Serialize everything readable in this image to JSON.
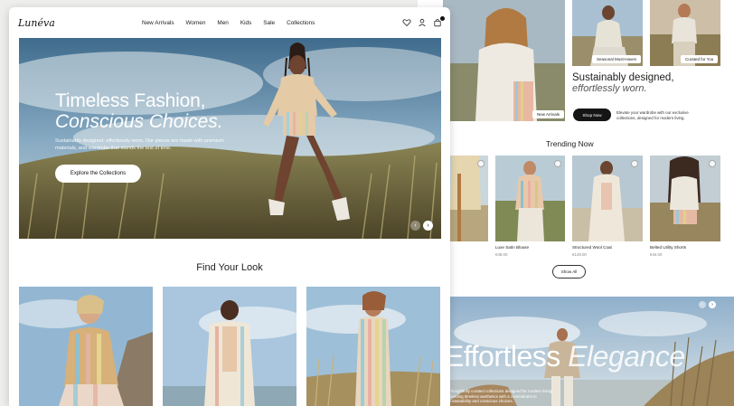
{
  "brand": {
    "logo": "Lunéva"
  },
  "nav": {
    "items": [
      {
        "label": "New Arrivals"
      },
      {
        "label": "Women"
      },
      {
        "label": "Men"
      },
      {
        "label": "Kids"
      },
      {
        "label": "Sale"
      },
      {
        "label": "Collections"
      }
    ]
  },
  "header_icons": [
    "heart-icon",
    "user-icon",
    "bag-icon"
  ],
  "hero": {
    "title_line1": "Timeless Fashion,",
    "title_line2": "Conscious Choices.",
    "description": "Sustainably designed, effortlessly worn. Our pieces are made with premium materials, and wardrobe that stands the test of time.",
    "cta": "Explore the Collections"
  },
  "find_your_look": {
    "title": "Find Your Look"
  },
  "back_page": {
    "badges": {
      "new_arrivals": "New Arrivals",
      "seasonal": "Seasonal Must-Haves",
      "curated": "Curated for You"
    },
    "sustainably": {
      "title": "Sustainably designed,",
      "subtitle": "effortlessly worn.",
      "shop_now": "Shop Now",
      "elevate": "Elevate your wardrobe with our exclusive collections, designed for modern living."
    },
    "trending": {
      "title": "Trending Now",
      "products": [
        {
          "name": "n",
          "price": ""
        },
        {
          "name": "Luxe Satin Blouse",
          "price": "€49.00"
        },
        {
          "name": "Structured Wool Coat",
          "price": "€149.00"
        },
        {
          "name": "Belted Utility Shorts",
          "price": "€44.00"
        }
      ],
      "show_all": "Show All"
    },
    "effortless": {
      "word1": "Effortless",
      "word2": "Elegance",
      "description": "Thoughtfully curated collections designed for modern living, blending timeless aesthetics with a commitment to sustainability and conscious choices."
    }
  },
  "colors": {
    "accent_dark": "#151515",
    "sky": "#8fb3cf",
    "grass": "#6e6a45"
  }
}
